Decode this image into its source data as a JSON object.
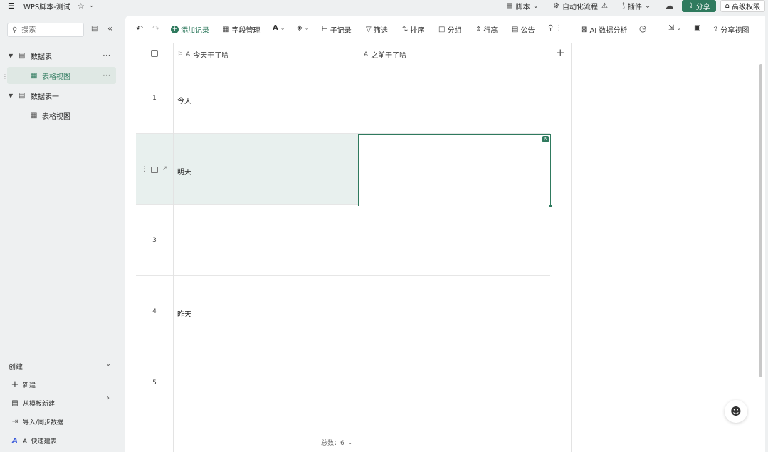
{
  "titlebar": {
    "menu_icon": "☰",
    "title": "WPS脚本-测试",
    "star_icon": "☆",
    "chevron": "⌄",
    "items": [
      {
        "icon": "▤",
        "label": "脚本",
        "dd": "⌄"
      },
      {
        "icon": "⚙",
        "label": "自动化流程",
        "dd": "⚠"
      },
      {
        "icon": "⟆",
        "label": "插件",
        "dd": "⌄"
      }
    ],
    "cloud_icon": "☁",
    "share_label": "分享",
    "share_icon": "⇪",
    "permission_label": "高级权限",
    "permission_icon": "⌂"
  },
  "sidebar": {
    "search_placeholder": "搜索",
    "tree": [
      {
        "label": "数据表",
        "type": "table",
        "level": 0,
        "expanded": true,
        "more": "···"
      },
      {
        "label": "表格视图",
        "type": "view",
        "level": 1,
        "active": true,
        "more": "···"
      },
      {
        "label": "数据表一",
        "type": "table",
        "level": 0,
        "expanded": true
      },
      {
        "label": "表格视图",
        "type": "view",
        "level": 1,
        "active": false
      }
    ],
    "create": {
      "heading": "创建",
      "items": [
        {
          "label": "新建",
          "icon": "+"
        },
        {
          "label": "从模板新建",
          "icon": "▤"
        },
        {
          "label": "导入/同步数据",
          "icon": "⇥"
        },
        {
          "label": "AI 快速建表",
          "icon": "A"
        }
      ]
    }
  },
  "toolbar": {
    "undo": "↶",
    "redo": "↷",
    "add_record": "添加记录",
    "field_manage": "字段管理",
    "font_color": "A",
    "fill_color": "◈",
    "sub_record": "子记录",
    "filter": "筛选",
    "sort": "排序",
    "group": "分组",
    "row_height": "行高",
    "notice": "公告",
    "search_more": "Q",
    "ai_analysis": "AI 数据分析",
    "history": "◷",
    "export": "⇲",
    "clipboard": "▣",
    "share_view": "分享视图"
  },
  "grid": {
    "columns": [
      {
        "label": "今天干了啥",
        "type_icon": "A",
        "primary_icon": "⚐"
      },
      {
        "label": "之前干了啥",
        "type_icon": "A"
      }
    ],
    "rows": [
      {
        "num": "1",
        "c1": "今天",
        "c2": ""
      },
      {
        "num": "",
        "c1": "明天",
        "c2": "",
        "hovered": true
      },
      {
        "num": "3",
        "c1": "",
        "c2": ""
      },
      {
        "num": "4",
        "c1": "昨天",
        "c2": ""
      },
      {
        "num": "5",
        "c1": "",
        "c2": ""
      }
    ],
    "footer_count": "总数：6"
  },
  "colors": {
    "accent": "#2f7a5e",
    "sidebar_bg": "#eef0f1",
    "active_item_bg": "#dfe8e4",
    "hover_row_bg": "#e8f0ee"
  }
}
